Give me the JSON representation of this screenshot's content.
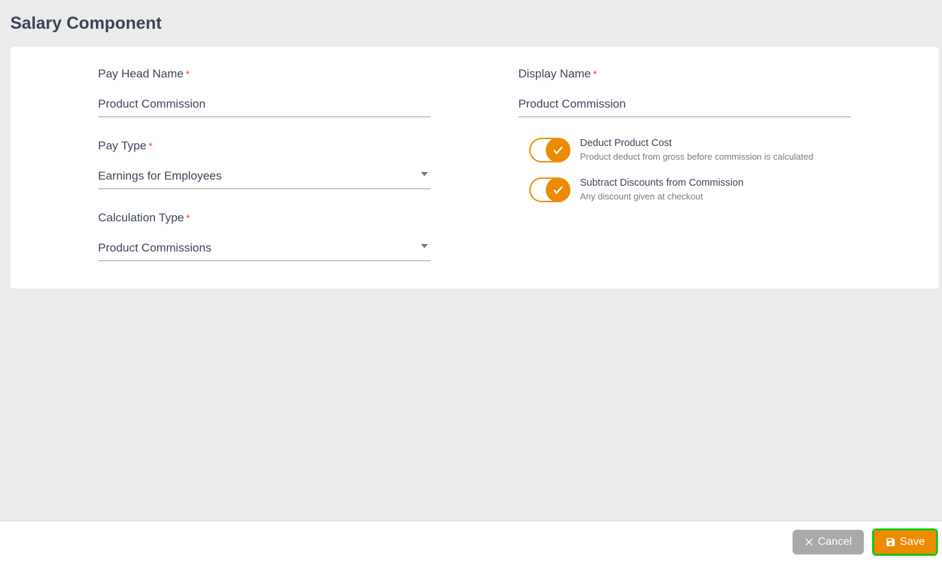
{
  "page": {
    "title": "Salary Component"
  },
  "fields": {
    "pay_head": {
      "label": "Pay Head Name",
      "value": "Product Commission"
    },
    "display_name": {
      "label": "Display Name",
      "value": "Product Commission"
    },
    "pay_type": {
      "label": "Pay Type",
      "value": "Earnings for Employees"
    },
    "calc_type": {
      "label": "Calculation Type",
      "value": "Product Commissions"
    }
  },
  "toggles": {
    "deduct_cost": {
      "title": "Deduct Product Cost",
      "desc": "Product deduct from gross before commission is calculated",
      "on": true
    },
    "subtract_disc": {
      "title": "Subtract Discounts from Commission",
      "desc": "Any discount given at checkout",
      "on": true
    }
  },
  "footer": {
    "cancel": "Cancel",
    "save": "Save"
  }
}
